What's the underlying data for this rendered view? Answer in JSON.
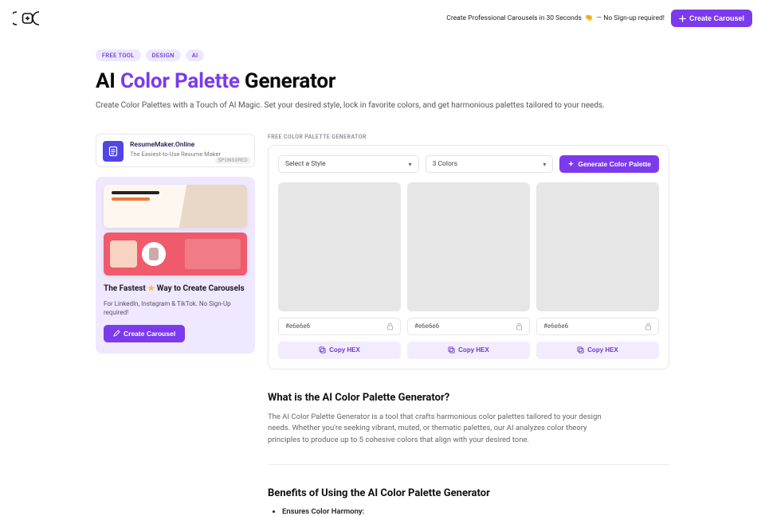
{
  "header": {
    "promo_text": "Create Professional Carousels in 30 Seconds",
    "promo_note": "— No Sign-up required!",
    "pinch_emoji": "🤏",
    "cta": "Create Carousel"
  },
  "badges": [
    "FREE TOOL",
    "DESIGN",
    "AI"
  ],
  "title_pre": "AI ",
  "title_accent": "Color Palette",
  "title_post": " Generator",
  "subtitle": "Create Color Palettes with a Touch of AI Magic. Set your desired style, lock in favorite colors, and get harmonious palettes tailored to your needs.",
  "sidebar": {
    "ad": {
      "title": "ResumeMaker.Online",
      "subtitle": "The Easiest-to-Use Resume Maker",
      "sponsored": "SPONSORED"
    },
    "promo": {
      "title_pre": "The Fastest ",
      "title_post": " Way to Create Carousels",
      "sub": "For LinkedIn, Instagram & TikTok. No Sign-Up required!",
      "cta": "Create Carousel"
    }
  },
  "generator": {
    "label": "FREE COLOR PALETTE GENERATOR",
    "style_select": "Select a Style",
    "count_select": "3 Colors",
    "generate": "Generate Color Palette",
    "swatches": [
      {
        "hex": "#e6e6e6",
        "copy": "Copy HEX"
      },
      {
        "hex": "#e6e6e6",
        "copy": "Copy HEX"
      },
      {
        "hex": "#e6e6e6",
        "copy": "Copy HEX"
      }
    ]
  },
  "article": {
    "h1": "What is the AI Color Palette Generator?",
    "p1": "The AI Color Palette Generator is a tool that crafts harmonious color palettes tailored to your design needs. Whether you're seeking vibrant, muted, or thematic palettes, our AI analyzes color theory principles to produce up to 5 cohesive colors that align with your desired tone.",
    "h2": "Benefits of Using the AI Color Palette Generator",
    "bullet1": "Ensures Color Harmony:"
  }
}
